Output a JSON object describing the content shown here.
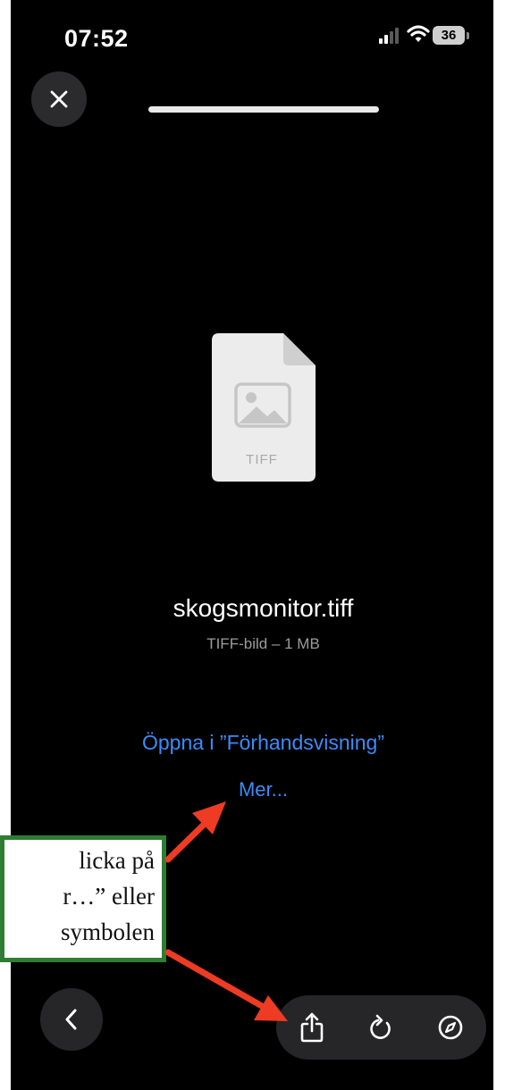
{
  "status_bar": {
    "time": "07:52",
    "battery_level": "36"
  },
  "file": {
    "name": "skogsmonitor.tiff",
    "meta": "TIFF-bild – 1 MB",
    "type_label": "TIFF"
  },
  "actions": {
    "open_in": "Öppna i ”Förhandsvisning”",
    "more": "Mer..."
  },
  "annotation": {
    "line1": "licka på",
    "line2": "r…” eller",
    "line3": "symbolen"
  },
  "icons": {
    "close": "close-icon",
    "back": "chevron-left-icon",
    "share": "share-icon",
    "rotate": "rotate-icon",
    "safari": "compass-icon",
    "file": "image-file-icon"
  },
  "colors": {
    "background": "#000000",
    "link": "#3d8bf7",
    "callout_border": "#2e7d32",
    "arrow": "#ee3b24"
  }
}
